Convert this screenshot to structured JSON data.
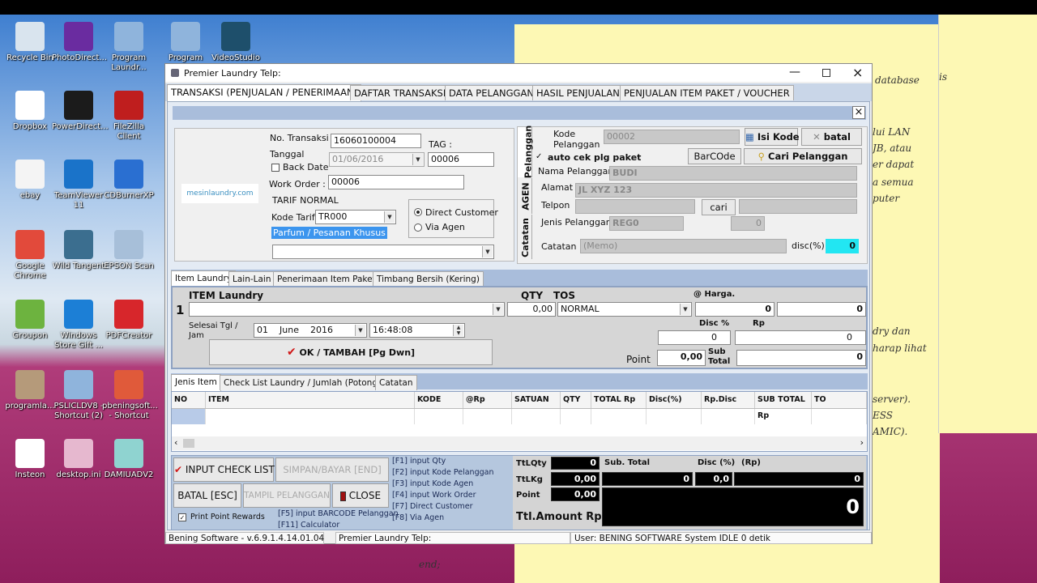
{
  "desktop": {
    "icons": [
      {
        "label": "Recycle Bin",
        "color": "#d9e4ee"
      },
      {
        "label": "Dropbox",
        "color": "#ffffff"
      },
      {
        "label": "ebay",
        "color": "#f4f4f4"
      },
      {
        "label": "Google Chrome",
        "color": "#e24a3b"
      },
      {
        "label": "Groupon",
        "color": "#6db33f"
      },
      {
        "label": "programla...",
        "color": "#b59a7a"
      },
      {
        "label": "Insteon",
        "color": "#ffffff"
      },
      {
        "label": "PhotoDirect...",
        "color": "#6a2ca0"
      },
      {
        "label": "PowerDirect...",
        "color": "#1b1b1b"
      },
      {
        "label": "TeamViewer 11",
        "color": "#1a73c9"
      },
      {
        "label": "Wild Tangent",
        "color": "#3b6e8f"
      },
      {
        "label": "Windows Store Gift ...",
        "color": "#1c7fd6"
      },
      {
        "label": "PSLICLDV8 - Shortcut (2)",
        "color": "#8fb4dc"
      },
      {
        "label": "desktop.ini",
        "color": "#e6b8cf"
      },
      {
        "label": "Program Laundr...",
        "color": "#8fb4dc"
      },
      {
        "label": "FileZilla Client",
        "color": "#bf1e1e"
      },
      {
        "label": "CDBurnerXP",
        "color": "#2a6fd1"
      },
      {
        "label": "EPSON Scan",
        "color": "#a7bfd9"
      },
      {
        "label": "PDFCreator",
        "color": "#d7262b"
      },
      {
        "label": "pbeningsoft... - Shortcut",
        "color": "#e05a3a"
      },
      {
        "label": "DAMIUADV2",
        "color": "#8fd3d0"
      },
      {
        "label": "Program",
        "color": "#8fb4dc"
      },
      {
        "label": "VideoStudio",
        "color": "#1e4f6b"
      }
    ],
    "note_lines": [
      "database",
      "is",
      "lui LAN",
      "JB, atau",
      "er dapat",
      "a semua",
      "puter",
      "dry dan",
      "harap lihat",
      "server).",
      "ESS",
      "AMIC).",
      "end;"
    ]
  },
  "window": {
    "title": "Premier Laundry  Telp:",
    "tabs": [
      "TRANSAKSI (PENJUALAN / PENERIMAAN)",
      "DAFTAR TRANSAKSI",
      "DATA PELANGGAN",
      "HASIL PENJUALAN",
      "PENJUALAN ITEM PAKET / VOUCHER"
    ],
    "close_x": "×"
  },
  "transaksi": {
    "logo": "mesinlaundry.com",
    "no_transaksi_label": "No. Transaksi",
    "no_transaksi": "16060100004",
    "tag_label": "TAG :",
    "tag": "00006",
    "tanggal_label": "Tanggal",
    "tanggal": "01/06/2016",
    "back_date_label": "Back Date",
    "work_order_label": "Work Order :",
    "work_order": "00006",
    "tarif_label": "TARIF NORMAL",
    "kode_tarif_label": "Kode Tarif",
    "kode_tarif": "TR000",
    "parfum_label": "Parfum / Pesanan Khusus",
    "parfum": "",
    "radio_direct": "Direct Customer",
    "radio_agen": "Via Agen",
    "selected": "Direct Customer"
  },
  "pelanggan": {
    "side_tabs": [
      "Pelanggan",
      "AGEN",
      "Catatan"
    ],
    "kode_label": "Kode Pelanggan",
    "kode": "00002",
    "isi_kode": "Isi Kode",
    "batal": "batal",
    "auto_cek": "auto cek plg paket",
    "auto_cek_checked": true,
    "barcode": "BarCOde",
    "cari_pelanggan": "Cari Pelanggan",
    "nama_label": "Nama Pelanggan",
    "nama": "BUDI",
    "alamat_label": "Alamat",
    "alamat": "JL XYZ 123",
    "telpon_label": "Telpon",
    "telpon": "",
    "cari": "cari",
    "telpon2": "",
    "jenis_label": "Jenis Pelanggan",
    "jenis": "REG0",
    "jenis_val": "0",
    "catatan_label": "Catatan",
    "catatan": "(Memo)",
    "disc_label": "disc(%)",
    "disc": "0"
  },
  "item": {
    "tabs": [
      "Item Laundry",
      "Lain-Lain",
      "Penerimaan Item Paket",
      "Timbang Bersih (Kering)"
    ],
    "row_no": "1",
    "item_label": "ITEM Laundry",
    "item": "",
    "qty_label": "QTY",
    "qty": "0,00",
    "tos_label": "TOS",
    "tos": "NORMAL",
    "harga_label": "@ Harga.",
    "harga": "0",
    "harga2": "0",
    "selesai_label": "Selesai Tgl / Jam",
    "tgl_day": "01",
    "tgl_month": "June",
    "tgl_year": "2016",
    "jam": "16:48:08",
    "ok_button": "OK / TAMBAH [Pg Dwn]",
    "disc_pct_label": "Disc %",
    "disc_pct": "0",
    "rp_label": "Rp",
    "rp": "0",
    "point_label": "Point",
    "point": "0,00",
    "subtotal_label": "Sub Total",
    "subtotal": "0"
  },
  "grid": {
    "tabs": [
      "Jenis Item",
      "Check List Laundry / Jumlah (Potong)",
      "Catatan"
    ],
    "columns": [
      "NO",
      "ITEM",
      "KODE",
      "@Rp",
      "SATUAN",
      "QTY",
      "TOTAL Rp",
      "Disc(%)",
      "Rp.Disc",
      "SUB TOTAL Rp",
      "TO"
    ]
  },
  "bottom": {
    "input_check_list": "INPUT CHECK LIST",
    "simpan": "SIMPAN/BAYAR [END]",
    "batal": "BATAL [ESC]",
    "tampil": "TAMPIL PELANGGAN",
    "close": "CLOSE",
    "print_point": "Print Point Rewards",
    "print_point_checked": true,
    "fkeys_left": [
      "[F5] input BARCODE Pelanggan",
      "[F11] Calculator"
    ],
    "fkeys": [
      "[F1] input Qty",
      "[F2] input Kode Pelanggan",
      "[F3] input Kode Agen",
      "[F4] input Work Order",
      "[F7] Direct Customer",
      "[F8] Via Agen"
    ],
    "ttlqty_label": "TtLQty",
    "ttlqty": "0",
    "ttlkg_label": "TtLKg",
    "ttlkg": "0,00",
    "point_label": "Point",
    "point": "0,00",
    "subtotal_label": "Sub. Total",
    "subtotal": "0",
    "disc_label": "Disc (%)",
    "disc": "0,0",
    "rp_label": "(Rp)",
    "rp": "0",
    "amount_label": "Ttl.Amount Rp",
    "amount": "0"
  },
  "status": {
    "version": "Bening Software  - v.6.9.1.4.14.01.04",
    "title": "Premier Laundry  Telp:",
    "user": "User: BENING SOFTWARE System IDLE  0 detik"
  }
}
